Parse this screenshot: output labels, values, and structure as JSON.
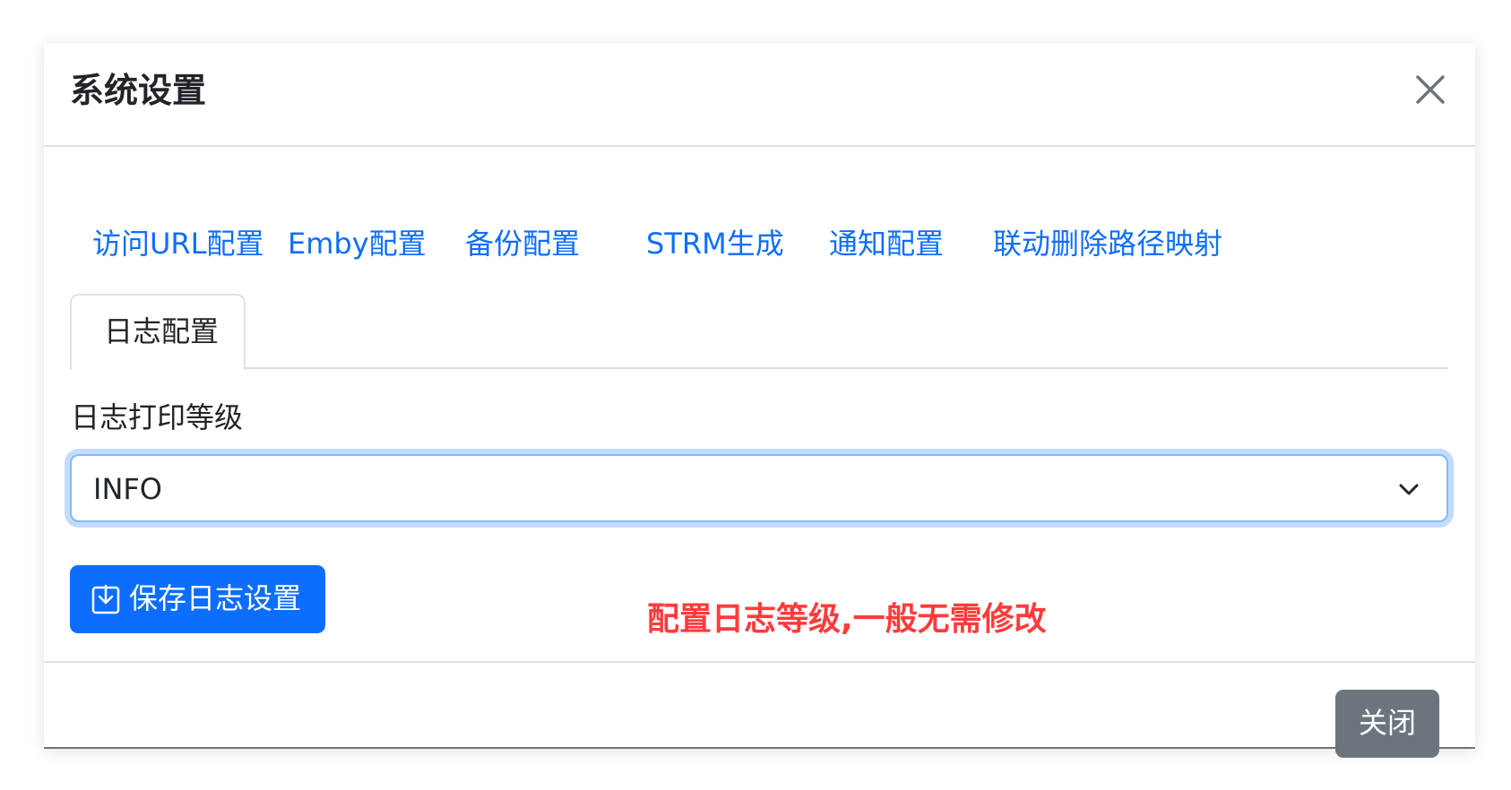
{
  "modal": {
    "title": "系统设置",
    "close_icon": "close-icon"
  },
  "tabs": [
    {
      "label": "访问URL配置",
      "active": false
    },
    {
      "label": "Emby配置",
      "active": false
    },
    {
      "label": "备份配置",
      "active": false
    },
    {
      "label": "STRM生成",
      "active": false
    },
    {
      "label": "通知配置",
      "active": false
    },
    {
      "label": "联动删除路径映射",
      "active": false
    },
    {
      "label": "日志配置",
      "active": true
    }
  ],
  "log_settings": {
    "level_label": "日志打印等级",
    "level_value": "INFO",
    "select_icon": "chevron-down-icon",
    "save_label": "保存日志设置",
    "save_icon": "save-download-icon"
  },
  "annotation": "配置日志等级,一般无需修改",
  "footer": {
    "close_label": "关闭"
  },
  "colors": {
    "primary": "#0d6efd",
    "secondary": "#6c757d",
    "annotation": "#ff3b3b",
    "focus_border": "#86b7fe"
  }
}
